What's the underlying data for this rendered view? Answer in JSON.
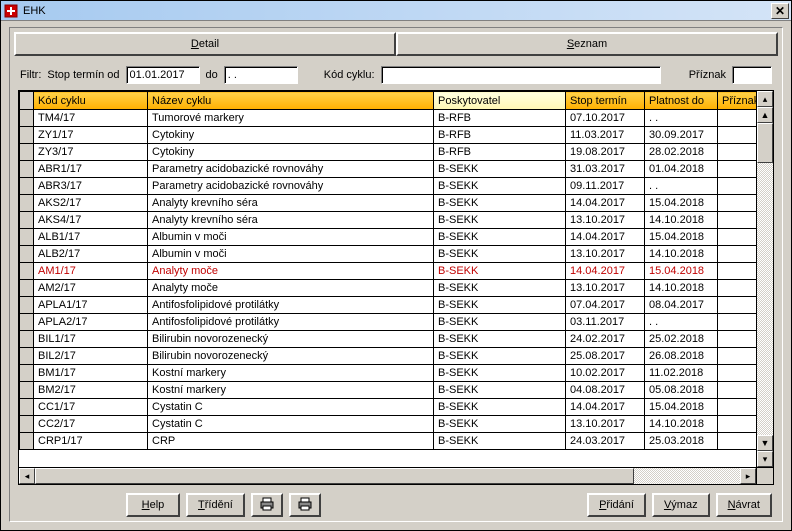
{
  "window": {
    "title": "EHK"
  },
  "tabs": {
    "detail": "Detail",
    "seznam": "Seznam"
  },
  "filter": {
    "label_filtr": "Filtr:",
    "label_stop": "Stop termín od",
    "date_from": "01.01.2017",
    "label_do": "do",
    "date_to": ". .",
    "label_kod": "Kód cyklu:",
    "kod_value": "",
    "label_priznak": "Příznak",
    "priznak_value": ""
  },
  "columns": {
    "kod": "Kód cyklu",
    "nazev": "Název cyklu",
    "poskytovatel": "Poskytovatel",
    "stop": "Stop termín",
    "platnost": "Platnost do",
    "priznak": "Příznak"
  },
  "rows": [
    {
      "kod": "TM4/17",
      "nazev": "Tumorové markery",
      "pos": "B-RFB",
      "stop": "07.10.2017",
      "plat": ". ."
    },
    {
      "kod": "ZY1/17",
      "nazev": "Cytokiny",
      "pos": "B-RFB",
      "stop": "11.03.2017",
      "plat": "30.09.2017"
    },
    {
      "kod": "ZY3/17",
      "nazev": "Cytokiny",
      "pos": "B-RFB",
      "stop": "19.08.2017",
      "plat": "28.02.2018"
    },
    {
      "kod": "ABR1/17",
      "nazev": "Parametry acidobazické rovnováhy",
      "pos": "B-SEKK",
      "stop": "31.03.2017",
      "plat": "01.04.2018"
    },
    {
      "kod": "ABR3/17",
      "nazev": "Parametry acidobazické rovnováhy",
      "pos": "B-SEKK",
      "stop": "09.11.2017",
      "plat": ". ."
    },
    {
      "kod": "AKS2/17",
      "nazev": "Analyty krevního séra",
      "pos": "B-SEKK",
      "stop": "14.04.2017",
      "plat": "15.04.2018"
    },
    {
      "kod": "AKS4/17",
      "nazev": "Analyty krevního séra",
      "pos": "B-SEKK",
      "stop": "13.10.2017",
      "plat": "14.10.2018"
    },
    {
      "kod": "ALB1/17",
      "nazev": "Albumin v moči",
      "pos": "B-SEKK",
      "stop": "14.04.2017",
      "plat": "15.04.2018"
    },
    {
      "kod": "ALB2/17",
      "nazev": "Albumin v moči",
      "pos": "B-SEKK",
      "stop": "13.10.2017",
      "plat": "14.10.2018"
    },
    {
      "kod": "AM1/17",
      "nazev": "Analyty moče",
      "pos": "B-SEKK",
      "stop": "14.04.2017",
      "plat": "15.04.2018",
      "red": true
    },
    {
      "kod": "AM2/17",
      "nazev": "Analyty moče",
      "pos": "B-SEKK",
      "stop": "13.10.2017",
      "plat": "14.10.2018"
    },
    {
      "kod": "APLA1/17",
      "nazev": "Antifosfolipidové protilátky",
      "pos": "B-SEKK",
      "stop": "07.04.2017",
      "plat": "08.04.2017"
    },
    {
      "kod": "APLA2/17",
      "nazev": "Antifosfolipidové protilátky",
      "pos": "B-SEKK",
      "stop": "03.11.2017",
      "plat": ". ."
    },
    {
      "kod": "BIL1/17",
      "nazev": "Bilirubin novorozenecký",
      "pos": "B-SEKK",
      "stop": "24.02.2017",
      "plat": "25.02.2018"
    },
    {
      "kod": "BIL2/17",
      "nazev": "Bilirubin novorozenecký",
      "pos": "B-SEKK",
      "stop": "25.08.2017",
      "plat": "26.08.2018"
    },
    {
      "kod": "BM1/17",
      "nazev": "Kostní markery",
      "pos": "B-SEKK",
      "stop": "10.02.2017",
      "plat": "11.02.2018"
    },
    {
      "kod": "BM2/17",
      "nazev": "Kostní markery",
      "pos": "B-SEKK",
      "stop": "04.08.2017",
      "plat": "05.08.2018"
    },
    {
      "kod": "CC1/17",
      "nazev": "Cystatin C",
      "pos": "B-SEKK",
      "stop": "14.04.2017",
      "plat": "15.04.2018"
    },
    {
      "kod": "CC2/17",
      "nazev": "Cystatin C",
      "pos": "B-SEKK",
      "stop": "13.10.2017",
      "plat": "14.10.2018"
    },
    {
      "kod": "CRP1/17",
      "nazev": "CRP",
      "pos": "B-SEKK",
      "stop": "24.03.2017",
      "plat": "25.03.2018"
    }
  ],
  "buttons": {
    "help": "Help",
    "trideni": "Třídění",
    "pridani": "Přidání",
    "vymaz": "Výmaz",
    "navrat": "Návrat"
  }
}
